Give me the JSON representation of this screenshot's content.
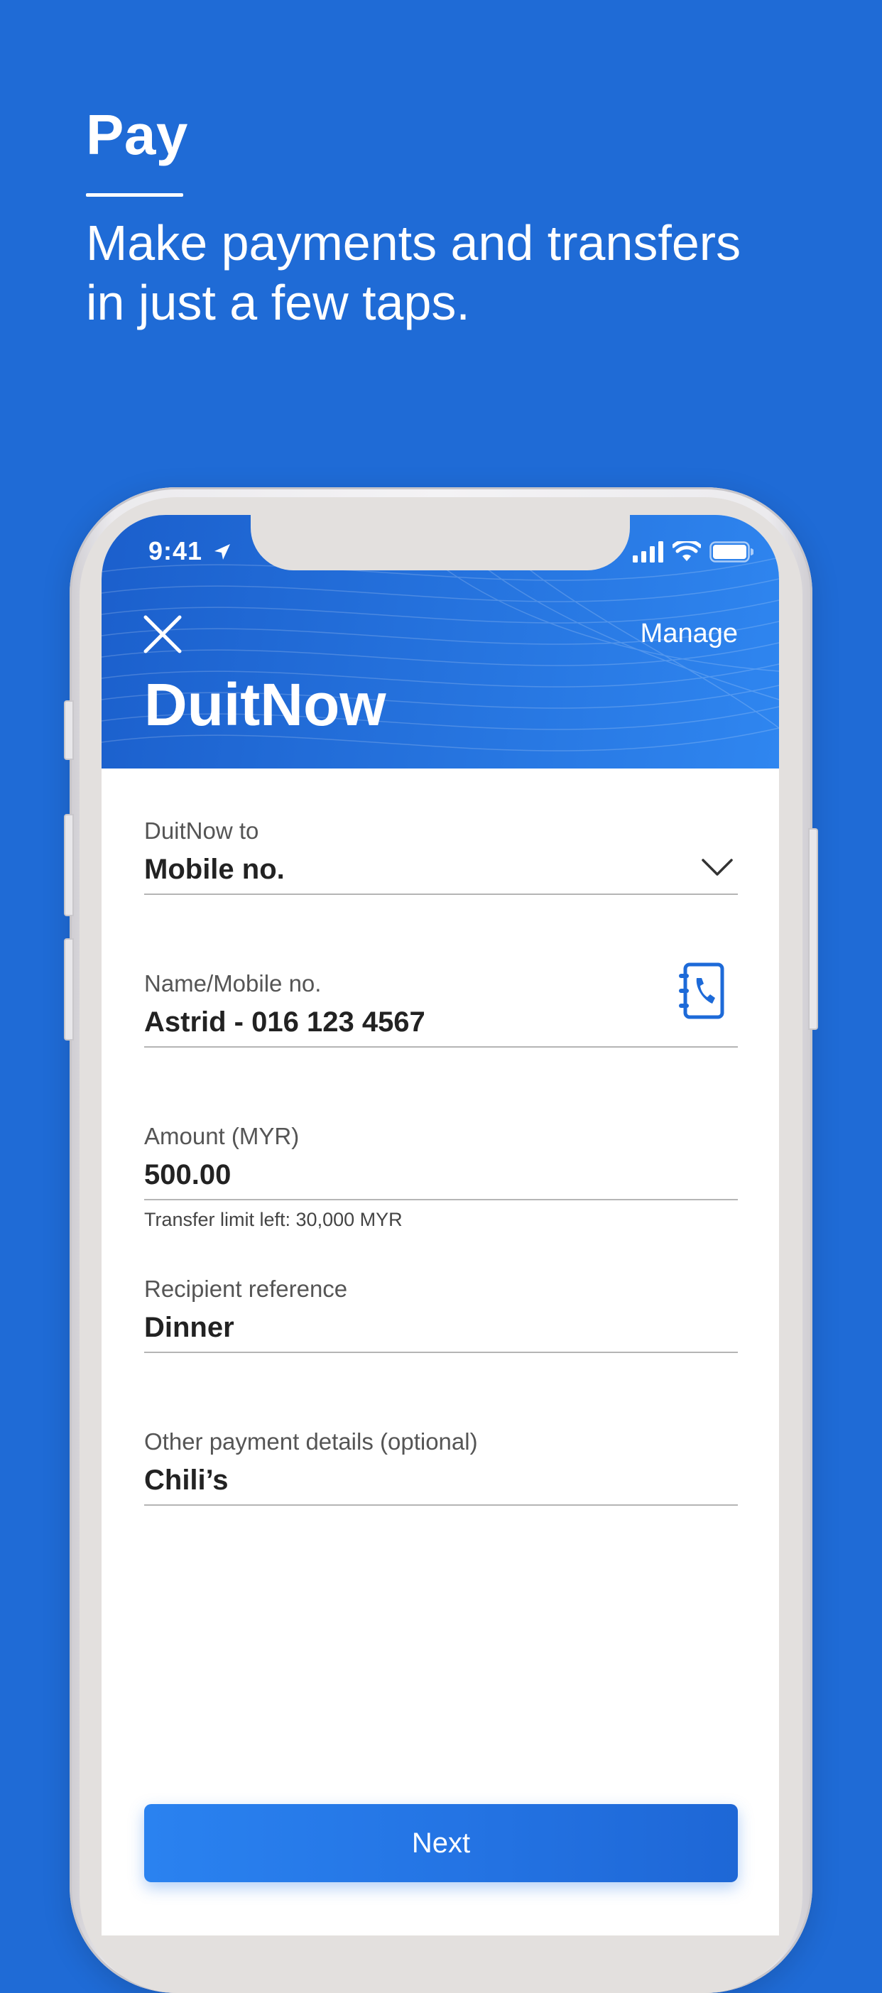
{
  "promo": {
    "title": "Pay",
    "subtitle_line1": "Make payments and transfers",
    "subtitle_line2": "in just a few taps."
  },
  "status_bar": {
    "time": "9:41",
    "icons": [
      "location-arrow-icon",
      "signal-icon",
      "wifi-icon",
      "battery-icon"
    ]
  },
  "header": {
    "close_icon": "close-icon",
    "manage_label": "Manage",
    "title": "DuitNow"
  },
  "form": {
    "duitnow_to": {
      "label": "DuitNow to",
      "value": "Mobile no.",
      "icon": "chevron-down-icon"
    },
    "name_mobile": {
      "label": "Name/Mobile no.",
      "value": "Astrid - 016 123 4567",
      "icon": "contacts-book-icon"
    },
    "amount": {
      "label": "Amount (MYR)",
      "value": "500.00",
      "helper": "Transfer limit left: 30,000 MYR"
    },
    "recipient_reference": {
      "label": "Recipient reference",
      "value": "Dinner"
    },
    "other_details": {
      "label": "Other payment details (optional)",
      "value": "Chili’s"
    }
  },
  "actions": {
    "next_label": "Next"
  },
  "colors": {
    "background": "#1f6bd6",
    "header_gradient_start": "#1b5fcc",
    "header_gradient_end": "#2f86f0",
    "button": "#2372e2",
    "icon_accent": "#1d6ad8"
  }
}
